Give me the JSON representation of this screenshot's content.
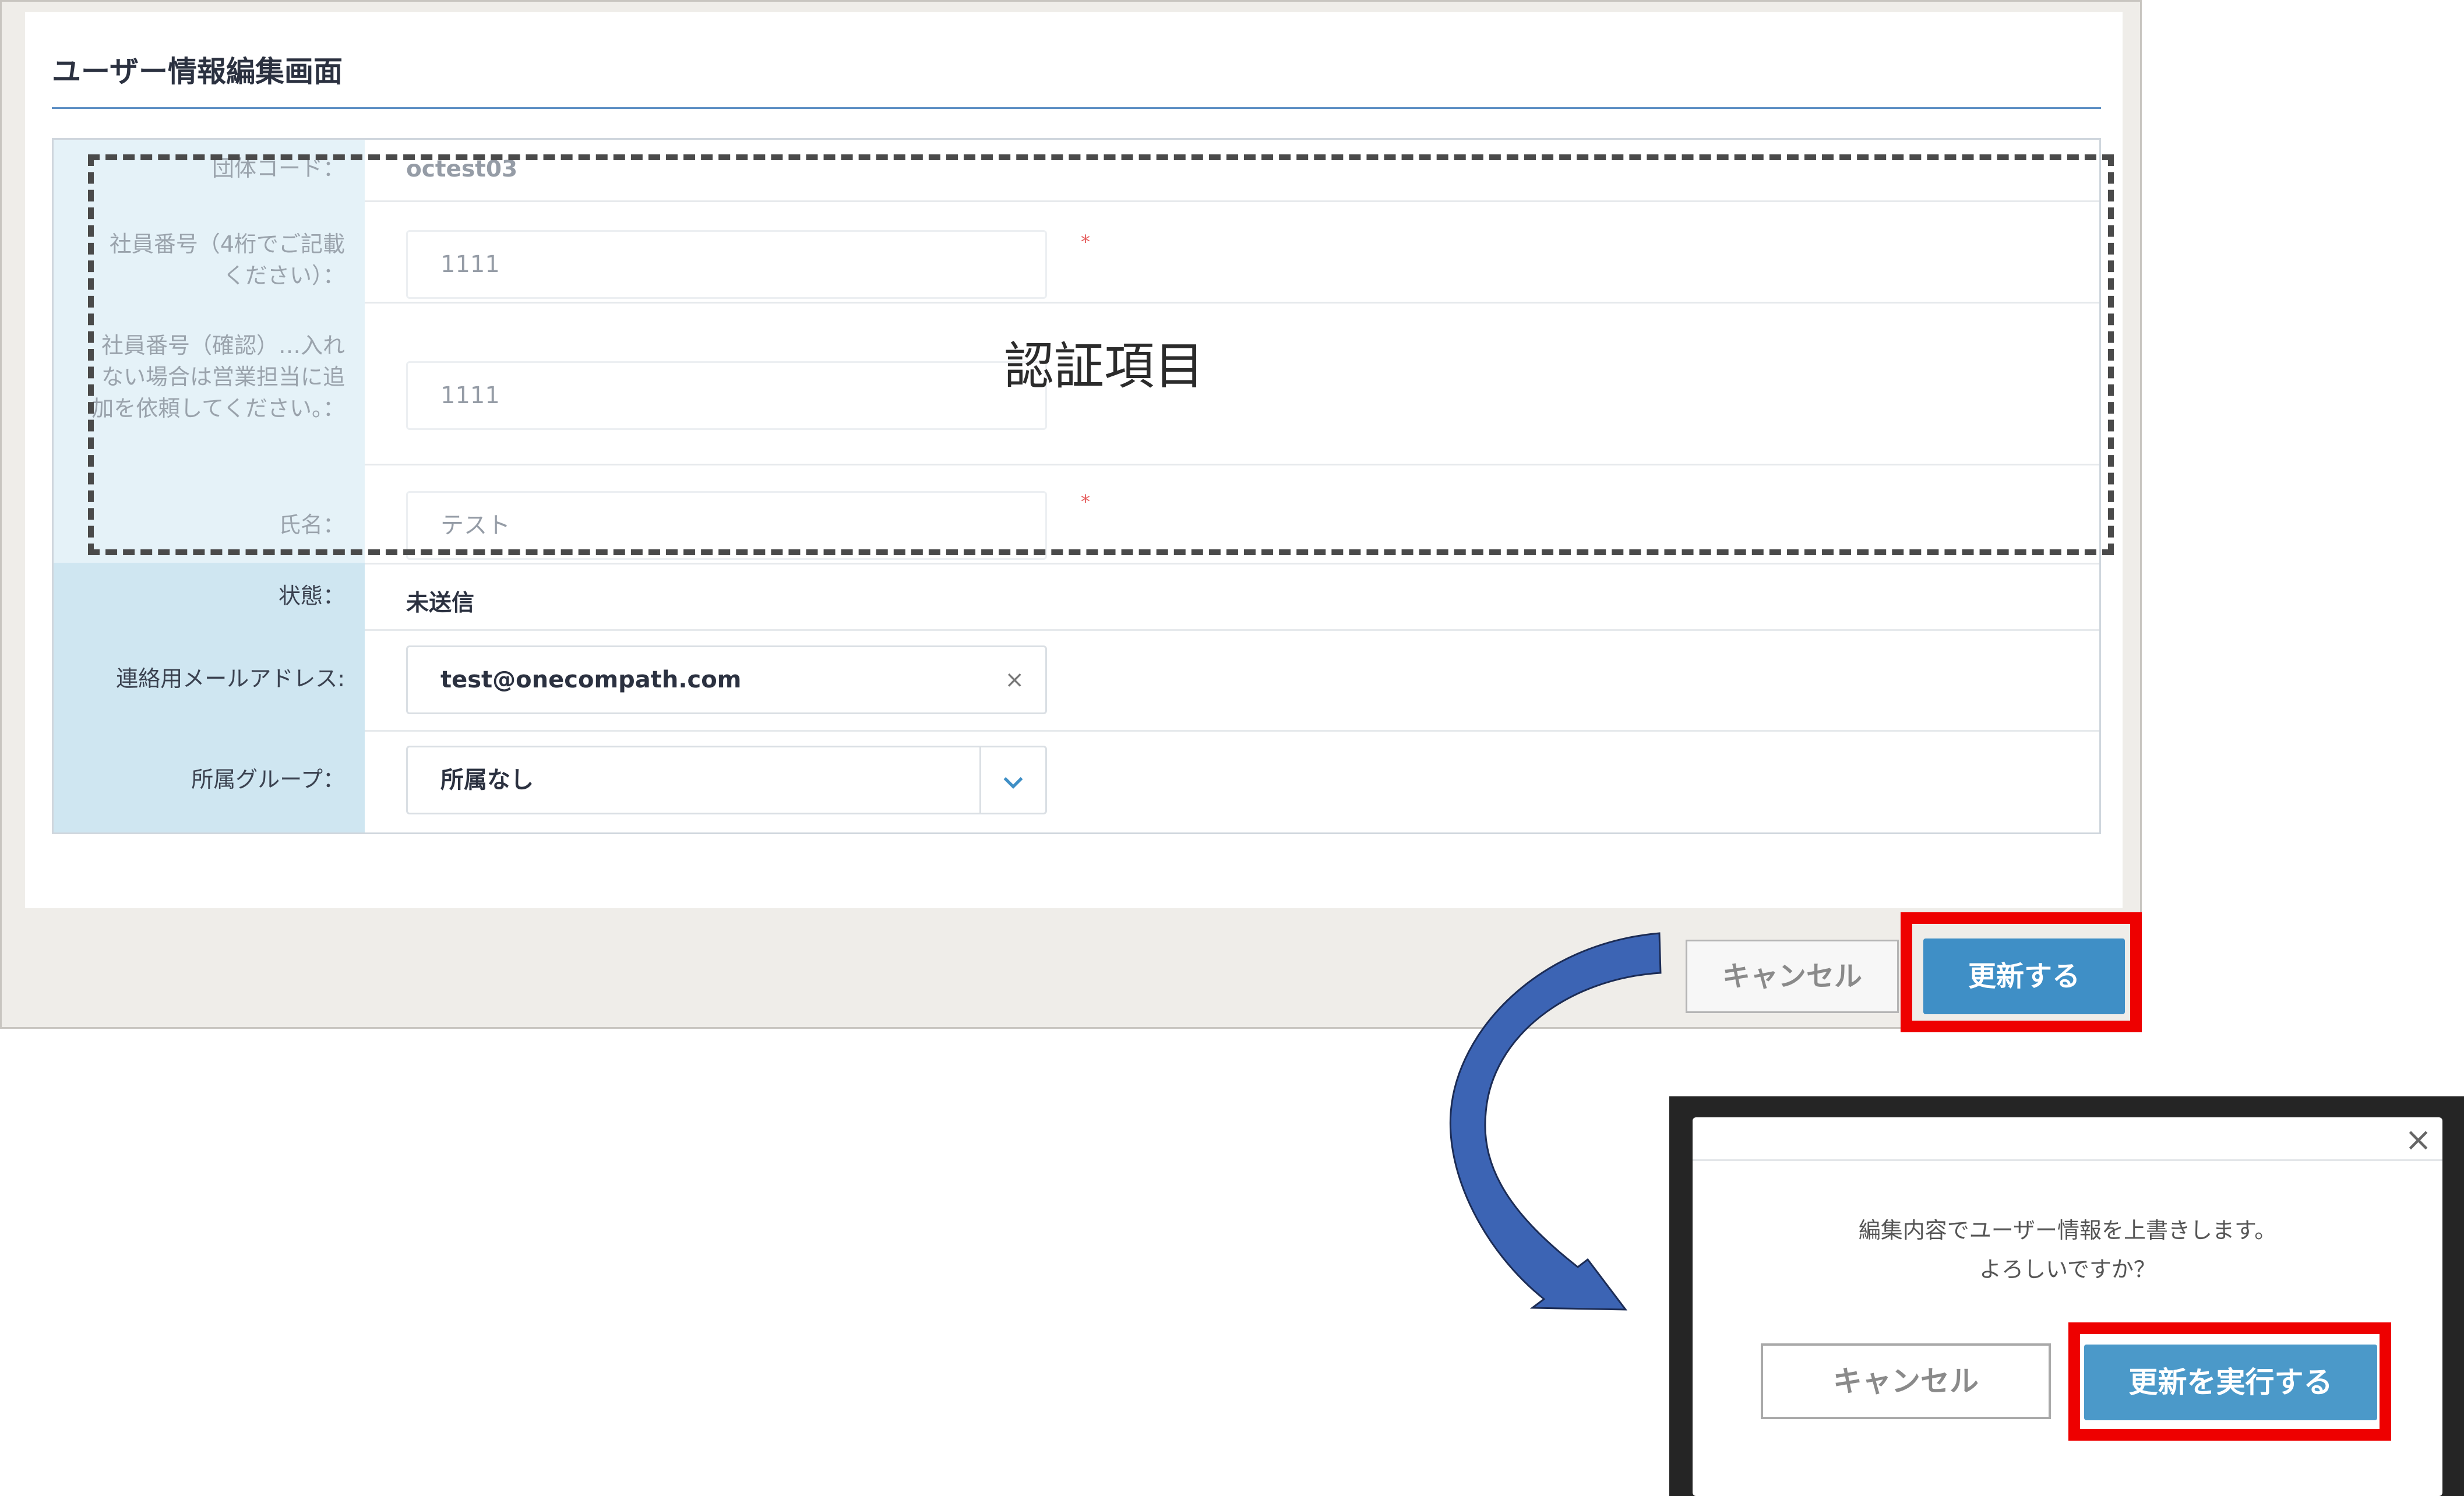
{
  "page": {
    "title": "ユーザー情報編集画面",
    "annotation": "認証項目"
  },
  "form": {
    "rows": [
      {
        "label": "団体コード：",
        "value": "octest03"
      },
      {
        "label": "社員番号（4桁でご記載ください）：",
        "value": "1111",
        "required": "*"
      },
      {
        "label": "社員番号（確認）…入れない場合は営業担当に追加を依頼してください。：",
        "value": "1111"
      },
      {
        "label": "氏名：",
        "value": "テスト",
        "required": "*"
      },
      {
        "label": "状態：",
        "value": "未送信"
      },
      {
        "label": "連絡用メールアドレス:",
        "value": "test@onecompath.com"
      },
      {
        "label": "所属グループ：",
        "value": "所属なし"
      }
    ],
    "clear_glyph": "×"
  },
  "actions": {
    "cancel_label": "キャンセル",
    "update_label": "更新する"
  },
  "dialog": {
    "close_glyph": "×",
    "message_line1": "編集内容でユーザー情報を上書きします。",
    "message_line2": "よろしいですか？",
    "cancel_label": "キャンセル",
    "execute_label": "更新を実行する"
  },
  "colors": {
    "primary_button": "#3f8fc6",
    "highlight_frame": "#ee0000",
    "label_column": "#cfe6f1",
    "arrow_fill": "#3c64b4"
  }
}
